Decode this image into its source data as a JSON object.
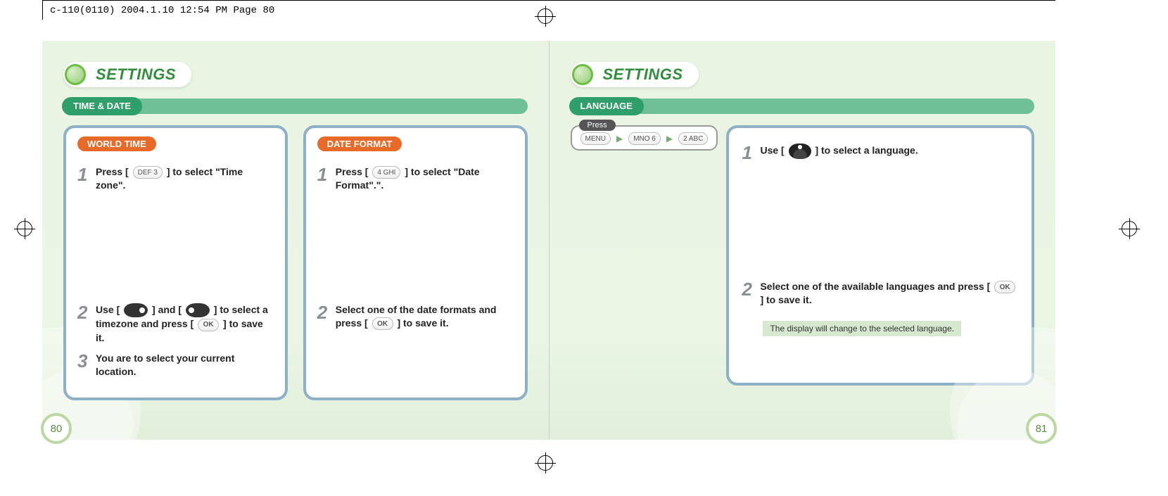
{
  "header": {
    "crop_info": "c-110(0110)  2004.1.10  12:54 PM  Page 80"
  },
  "left_page": {
    "title": "SETTINGS",
    "section": "TIME & DATE",
    "page_number": "80",
    "world_time": {
      "tab": "WORLD TIME",
      "step1_a": "Press [",
      "step1_key": "DEF 3",
      "step1_b": "] to select \"Time zone\".",
      "step2_a": "Use [",
      "step2_b": "] and [",
      "step2_c": "] to select a timezone and press [",
      "step2_ok": "OK",
      "step2_d": "] to save it.",
      "step3": "You are to select your current location."
    },
    "date_format": {
      "tab": "DATE FORMAT",
      "step1_a": "Press [",
      "step1_key": "4 GHI",
      "step1_b": "] to select \"Date Format\".\".",
      "step2_a": "Select one of the date formats and press [",
      "step2_ok": "OK",
      "step2_b": "] to save it."
    }
  },
  "right_page": {
    "title": "SETTINGS",
    "section": "LANGUAGE",
    "page_number": "81",
    "press_label": "Press",
    "press_keys": {
      "k1": "MENU",
      "k2": "MNO 6",
      "k3": "2 ABC"
    },
    "step1_a": "Use [",
    "step1_b": "] to select a language.",
    "step2_a": "Select one of the available languages and press [",
    "step2_ok": "OK",
    "step2_b": "] to save it.",
    "note": "The display will change to the selected language."
  }
}
